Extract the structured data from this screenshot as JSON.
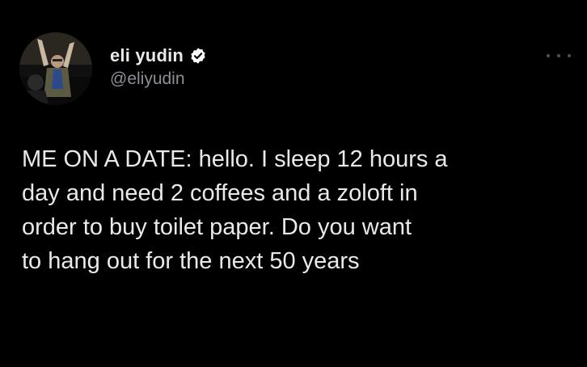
{
  "tweet": {
    "author": {
      "display_name": "eli yudin",
      "handle": "@eliyudin",
      "verified": true
    },
    "text": "ME ON A DATE: hello. I sleep 12 hours a\nday and need 2 coffees and a zoloft in\norder to buy toilet paper. Do you want\nto hang out for the next 50 years"
  },
  "icons": {
    "verified": "verified-badge-icon",
    "more": "more-options-icon"
  },
  "colors": {
    "background": "#000000",
    "text": "#e7e9ea",
    "secondary_text": "#8b9096",
    "verified_badge": "#ffffff"
  }
}
